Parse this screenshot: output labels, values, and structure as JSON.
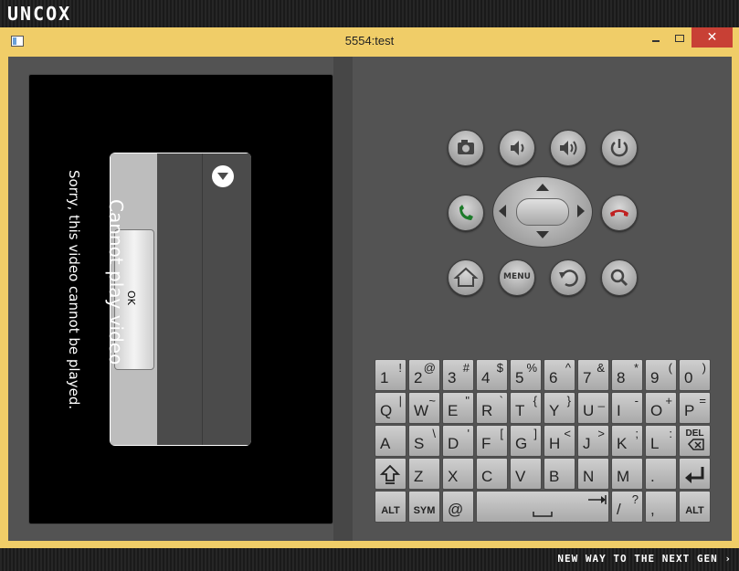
{
  "branding": {
    "logo": "UNCOX",
    "tagline": "NEW WAY TO THE NEXT GEN ›"
  },
  "window": {
    "title": "5554:test",
    "close": "✕"
  },
  "dialog": {
    "title": "Cannot play video",
    "message": "Sorry, this video cannot be played.",
    "ok_label": "OK"
  },
  "controls": {
    "menu_label": "MENU"
  },
  "keyboard": {
    "row1": [
      {
        "m": "1",
        "s": "!"
      },
      {
        "m": "2",
        "s": "@"
      },
      {
        "m": "3",
        "s": "#"
      },
      {
        "m": "4",
        "s": "$"
      },
      {
        "m": "5",
        "s": "%"
      },
      {
        "m": "6",
        "s": "^"
      },
      {
        "m": "7",
        "s": "&"
      },
      {
        "m": "8",
        "s": "*"
      },
      {
        "m": "9",
        "s": "("
      },
      {
        "m": "0",
        "s": ")"
      }
    ],
    "row2": [
      {
        "m": "Q",
        "s": "|"
      },
      {
        "m": "W",
        "s": "~"
      },
      {
        "m": "E",
        "s": "\""
      },
      {
        "m": "R",
        "s": "`"
      },
      {
        "m": "T",
        "s": "{"
      },
      {
        "m": "Y",
        "s": "}"
      },
      {
        "m": "U",
        "s": "_"
      },
      {
        "m": "I",
        "s": "-"
      },
      {
        "m": "O",
        "s": "+"
      },
      {
        "m": "P",
        "s": "="
      }
    ],
    "row3": [
      {
        "m": "A",
        "s": ""
      },
      {
        "m": "S",
        "s": "\\"
      },
      {
        "m": "D",
        "s": "'"
      },
      {
        "m": "F",
        "s": "["
      },
      {
        "m": "G",
        "s": "]"
      },
      {
        "m": "H",
        "s": "<"
      },
      {
        "m": "J",
        "s": ">"
      },
      {
        "m": "K",
        "s": ";"
      },
      {
        "m": "L",
        "s": ":"
      }
    ],
    "del_label": "DEL",
    "row4": [
      "Z",
      "X",
      "C",
      "V",
      "B",
      "N",
      "M",
      "."
    ],
    "alt_label": "ALT",
    "sym_label": "SYM",
    "at_label": "@",
    "slash": {
      "m": "/",
      "s": "?"
    },
    "comma": ","
  }
}
